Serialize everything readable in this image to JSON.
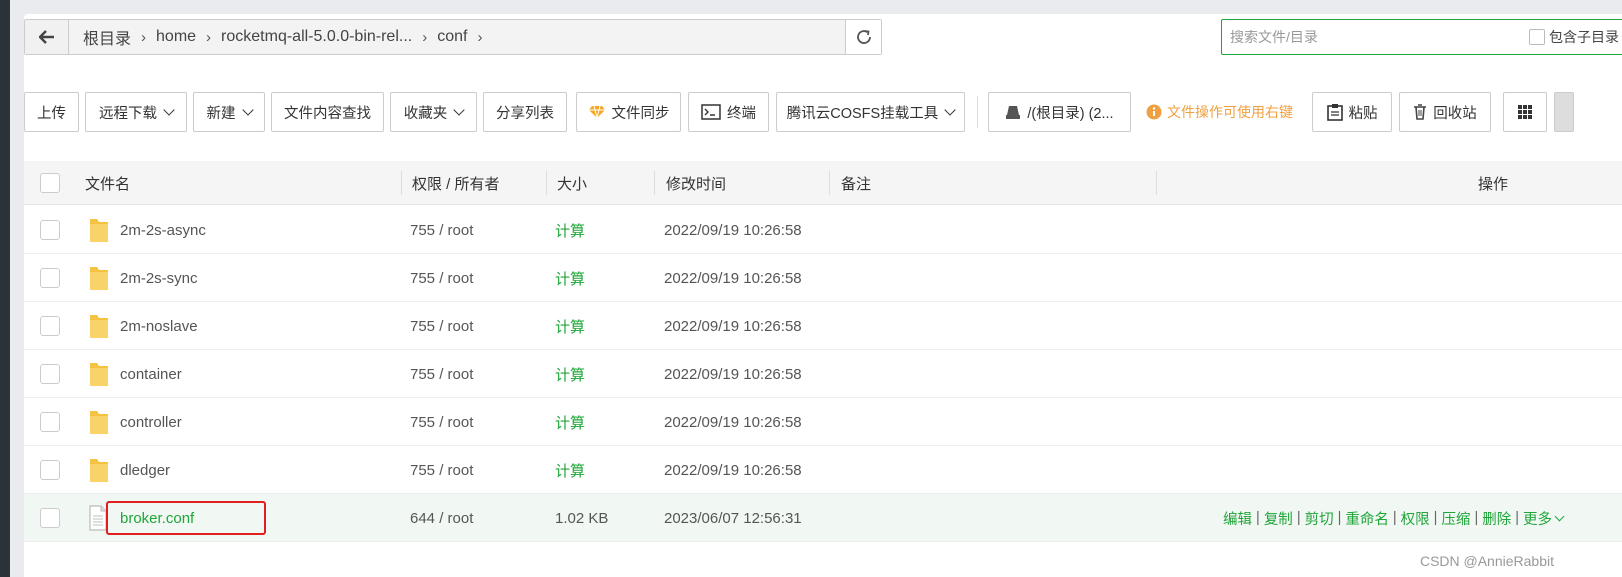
{
  "path": {
    "back_icon": "arrow-left-icon",
    "crumbs": [
      "根目录",
      "home",
      "rocketmq-all-5.0.0-bin-rel...",
      "conf"
    ],
    "refresh_icon": "refresh-icon"
  },
  "search": {
    "placeholder": "搜索文件/目录",
    "include_sub_label": "包含子目录"
  },
  "toolbar": {
    "upload": "上传",
    "remote_download": "远程下载",
    "new": "新建",
    "content_search": "文件内容查找",
    "favorites": "收藏夹",
    "share_list": "分享列表",
    "file_sync": "文件同步",
    "terminal": "终端",
    "cosfs": "腾讯云COSFS挂载工具",
    "disk": "/(根目录) (2...",
    "hint": "文件操作可使用右键",
    "paste": "粘贴",
    "recycle": "回收站"
  },
  "table": {
    "headers": {
      "name": "文件名",
      "perm": "权限 / 所有者",
      "size": "大小",
      "mtime": "修改时间",
      "remark": "备注",
      "ops": "操作"
    },
    "rows": [
      {
        "name": "2m-2s-async",
        "type": "folder",
        "perm": "755 / root",
        "size": "计算",
        "mtime": "2022/09/19 10:26:58"
      },
      {
        "name": "2m-2s-sync",
        "type": "folder",
        "perm": "755 / root",
        "size": "计算",
        "mtime": "2022/09/19 10:26:58"
      },
      {
        "name": "2m-noslave",
        "type": "folder",
        "perm": "755 / root",
        "size": "计算",
        "mtime": "2022/09/19 10:26:58"
      },
      {
        "name": "container",
        "type": "folder",
        "perm": "755 / root",
        "size": "计算",
        "mtime": "2022/09/19 10:26:58"
      },
      {
        "name": "controller",
        "type": "folder",
        "perm": "755 / root",
        "size": "计算",
        "mtime": "2022/09/19 10:26:58"
      },
      {
        "name": "dledger",
        "type": "folder",
        "perm": "755 / root",
        "size": "计算",
        "mtime": "2022/09/19 10:26:58"
      },
      {
        "name": "broker.conf",
        "type": "file",
        "perm": "644 / root",
        "size": "1.02 KB",
        "mtime": "2023/06/07 12:56:31"
      }
    ],
    "row_ops": [
      "编辑",
      "复制",
      "剪切",
      "重命名",
      "权限",
      "压缩",
      "删除",
      "更多"
    ]
  },
  "colors": {
    "accent": "#20a53a",
    "hint": "#f0a040",
    "folder": "#f5c242",
    "highlight": "#e02020"
  },
  "watermark": "CSDN @AnnieRabbit"
}
